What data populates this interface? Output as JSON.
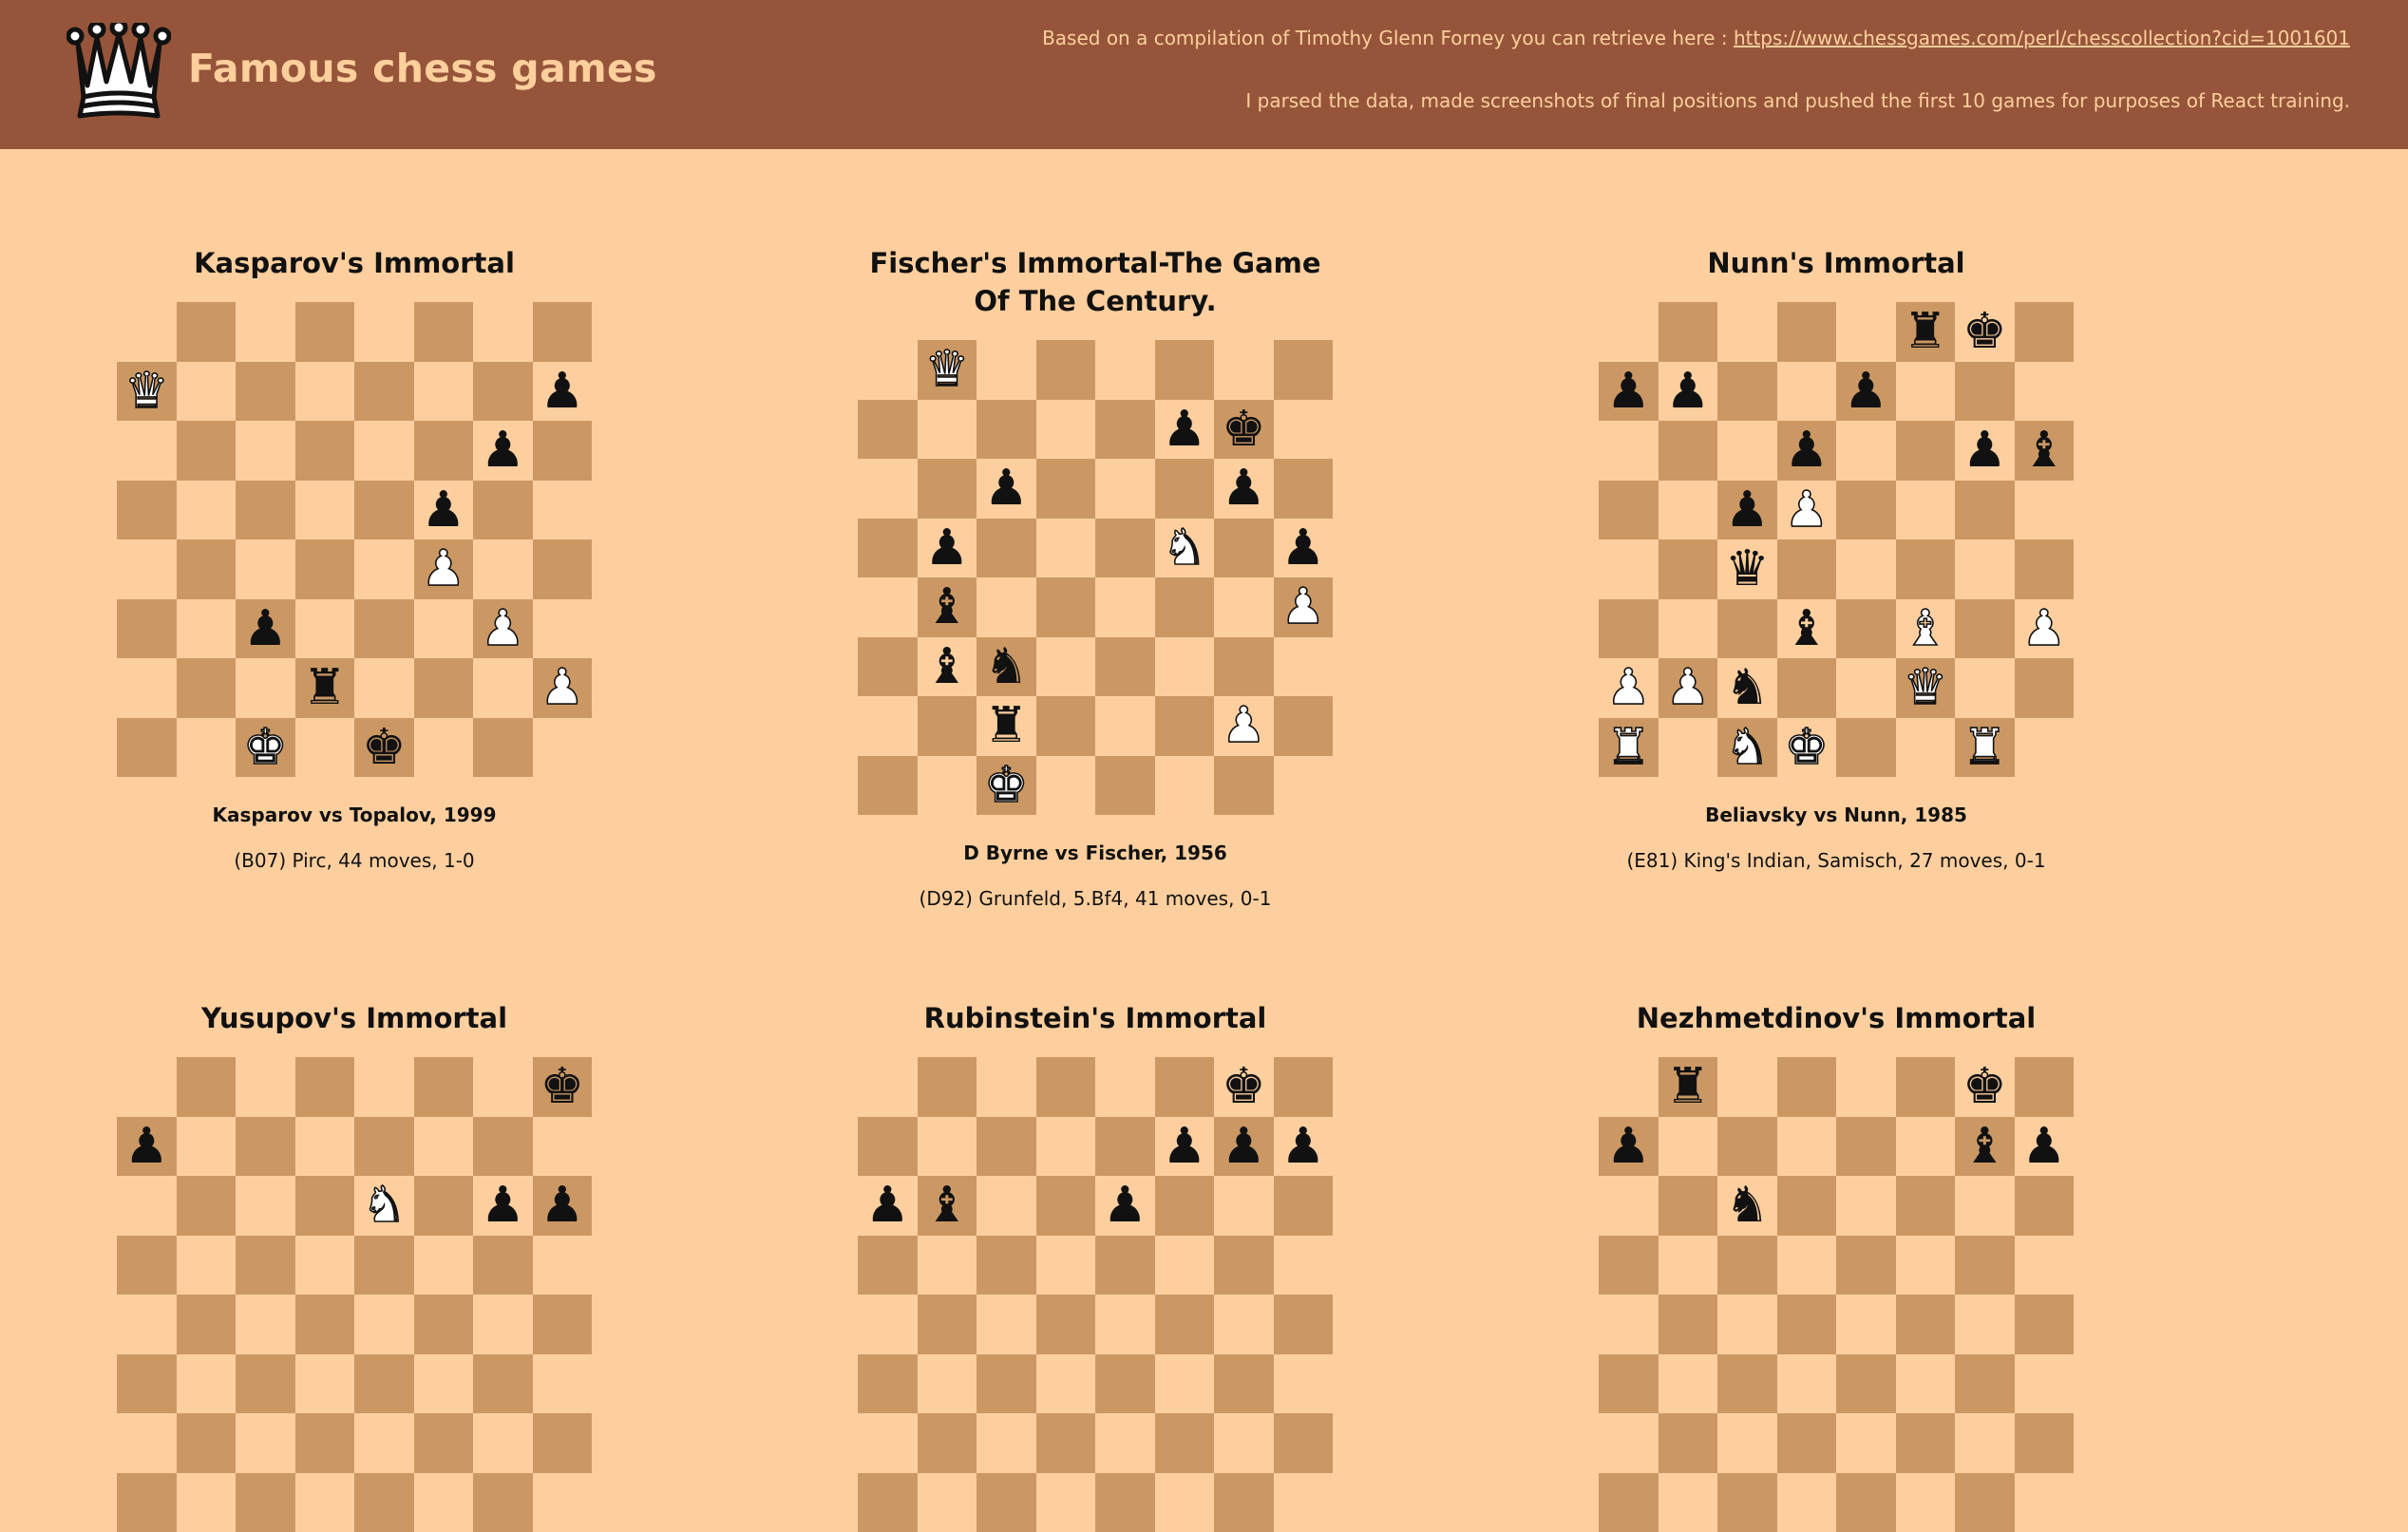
{
  "header": {
    "title": "Famous chess games",
    "logo_icon": "crown-icon",
    "credit_text": "Based on a compilation of Timothy Glenn Forney you can retrieve here : ",
    "credit_link": "https://www.chessgames.com/perl/chesscollection?cid=1001601",
    "note": "I parsed the data, made screenshots of final positions and pushed the first 10 games for purposes of React training."
  },
  "colors": {
    "header_bg": "#96553a",
    "page_bg": "#fecf9e",
    "light_square": "#fecf9e",
    "dark_square": "#cb9864",
    "title_text": "#fdcf9d"
  },
  "games": [
    {
      "title": "Kasparov's Immortal",
      "players": "Kasparov vs Topalov, 1999",
      "opening": "(B07) Pirc, 44 moves, 1-0",
      "board": [
        "........",
        "Q......p",
        "......p.",
        ".....p..",
        ".....P..",
        "..p...P.",
        "...r...P",
        "..K.k..."
      ]
    },
    {
      "title": "Fischer's Immortal-The Game Of The Century.",
      "players": "D Byrne vs Fischer, 1956",
      "opening": "(D92) Grunfeld, 5.Bf4, 41 moves, 0-1",
      "board": [
        ".Q......",
        ".....pk.",
        "..p...p.",
        ".p...N.p",
        ".b.....P",
        ".bn.....",
        "..r...P.",
        "..K....."
      ]
    },
    {
      "title": "Nunn's Immortal",
      "players": "Beliavsky vs Nunn, 1985",
      "opening": "(E81) King's Indian, Samisch, 27 moves, 0-1",
      "board": [
        ".....rk.",
        "pp..p...",
        "...p..pb",
        "..pP....",
        "..q.....",
        "...b.B.P",
        "PPn..Q..",
        "R.NK..R."
      ]
    },
    {
      "title": "Yusupov's Immortal",
      "players": "",
      "opening": "",
      "board": [
        ".......k",
        "p.......",
        "....N.pp",
        "........",
        "........",
        "........",
        "........",
        "........"
      ]
    },
    {
      "title": "Rubinstein's Immortal",
      "players": "",
      "opening": "",
      "board": [
        "......k.",
        ".....ppp",
        "pb..p...",
        "........",
        "........",
        "........",
        "........",
        "........"
      ]
    },
    {
      "title": "Nezhmetdinov's Immortal",
      "players": "",
      "opening": "",
      "board": [
        ".r....k.",
        "p.....bp",
        "..n.....",
        "........",
        "........",
        "........",
        "........",
        "........"
      ]
    }
  ]
}
